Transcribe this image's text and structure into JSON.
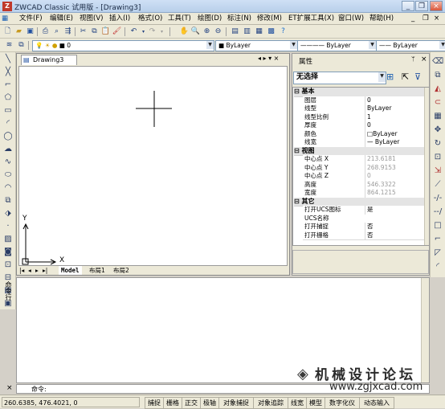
{
  "window": {
    "title": "ZWCAD Classic 试用版 - [Drawing3]",
    "app_icon": "Z",
    "minimize": "_",
    "restore": "❐",
    "close": "×",
    "doc_minimize": "_",
    "doc_restore": "❐",
    "doc_close": "×"
  },
  "menu": [
    "文件(F)",
    "编辑(E)",
    "视图(V)",
    "插入(I)",
    "格式(O)",
    "工具(T)",
    "绘图(D)",
    "标注(N)",
    "修改(M)",
    "ET扩展工具(X)",
    "窗口(W)",
    "帮助(H)"
  ],
  "layer_bar": {
    "layer_value": "0",
    "color_value": "ByLayer",
    "linetype_value": "ByLayer",
    "lineweight_value": "ByLayer"
  },
  "document": {
    "tab_title": "Drawing3",
    "tab_controls": "◂ ▸ ▾ ×",
    "axis_x": "X",
    "axis_y": "Y",
    "layout_tabs": [
      "Model",
      "布局1",
      "布局2"
    ],
    "nav_buttons": [
      "|◂",
      "◂",
      "▸",
      "▸|"
    ]
  },
  "properties": {
    "title": "属性",
    "pin": "ᛘ",
    "close": "×",
    "selection": "无选择",
    "sections": [
      {
        "name": "基本",
        "rows": [
          {
            "key": "图层",
            "value": "0"
          },
          {
            "key": "线型",
            "value": "ByLayer"
          },
          {
            "key": "线型比例",
            "value": "1"
          },
          {
            "key": "厚度",
            "value": "0"
          },
          {
            "key": "颜色",
            "value": "□ByLayer"
          },
          {
            "key": "线宽",
            "value": "— ByLayer"
          }
        ]
      },
      {
        "name": "视图",
        "rows": [
          {
            "key": "中心点 X",
            "value": "213.6181"
          },
          {
            "key": "中心点 Y",
            "value": "268.9153"
          },
          {
            "key": "中心点 Z",
            "value": "0"
          },
          {
            "key": "高度",
            "value": "546.3322"
          },
          {
            "key": "宽度",
            "value": "864.1215"
          }
        ]
      },
      {
        "name": "其它",
        "rows": [
          {
            "key": "打开UCS图标",
            "value": "是"
          },
          {
            "key": "UCS名称",
            "value": ""
          },
          {
            "key": "打开捕捉",
            "value": "否"
          },
          {
            "key": "打开栅格",
            "value": "否"
          }
        ]
      }
    ]
  },
  "command": {
    "side_label": "命令行",
    "prompt": "命令:",
    "close": "×"
  },
  "status": {
    "coords": "260.6385,  476.4021,  0",
    "buttons": [
      "捕捉",
      "栅格",
      "正交",
      "极轴",
      "对象捕捉",
      "对象追踪",
      "线宽",
      "模型",
      "数字化仪",
      "动态输入"
    ]
  },
  "watermark": {
    "text": "机械设计论坛",
    "url": "www.zgjxcad.com"
  },
  "colors": {
    "title_text": "#1a2a44",
    "canvas": "#ffffff",
    "chrome": "#ece9d8"
  }
}
